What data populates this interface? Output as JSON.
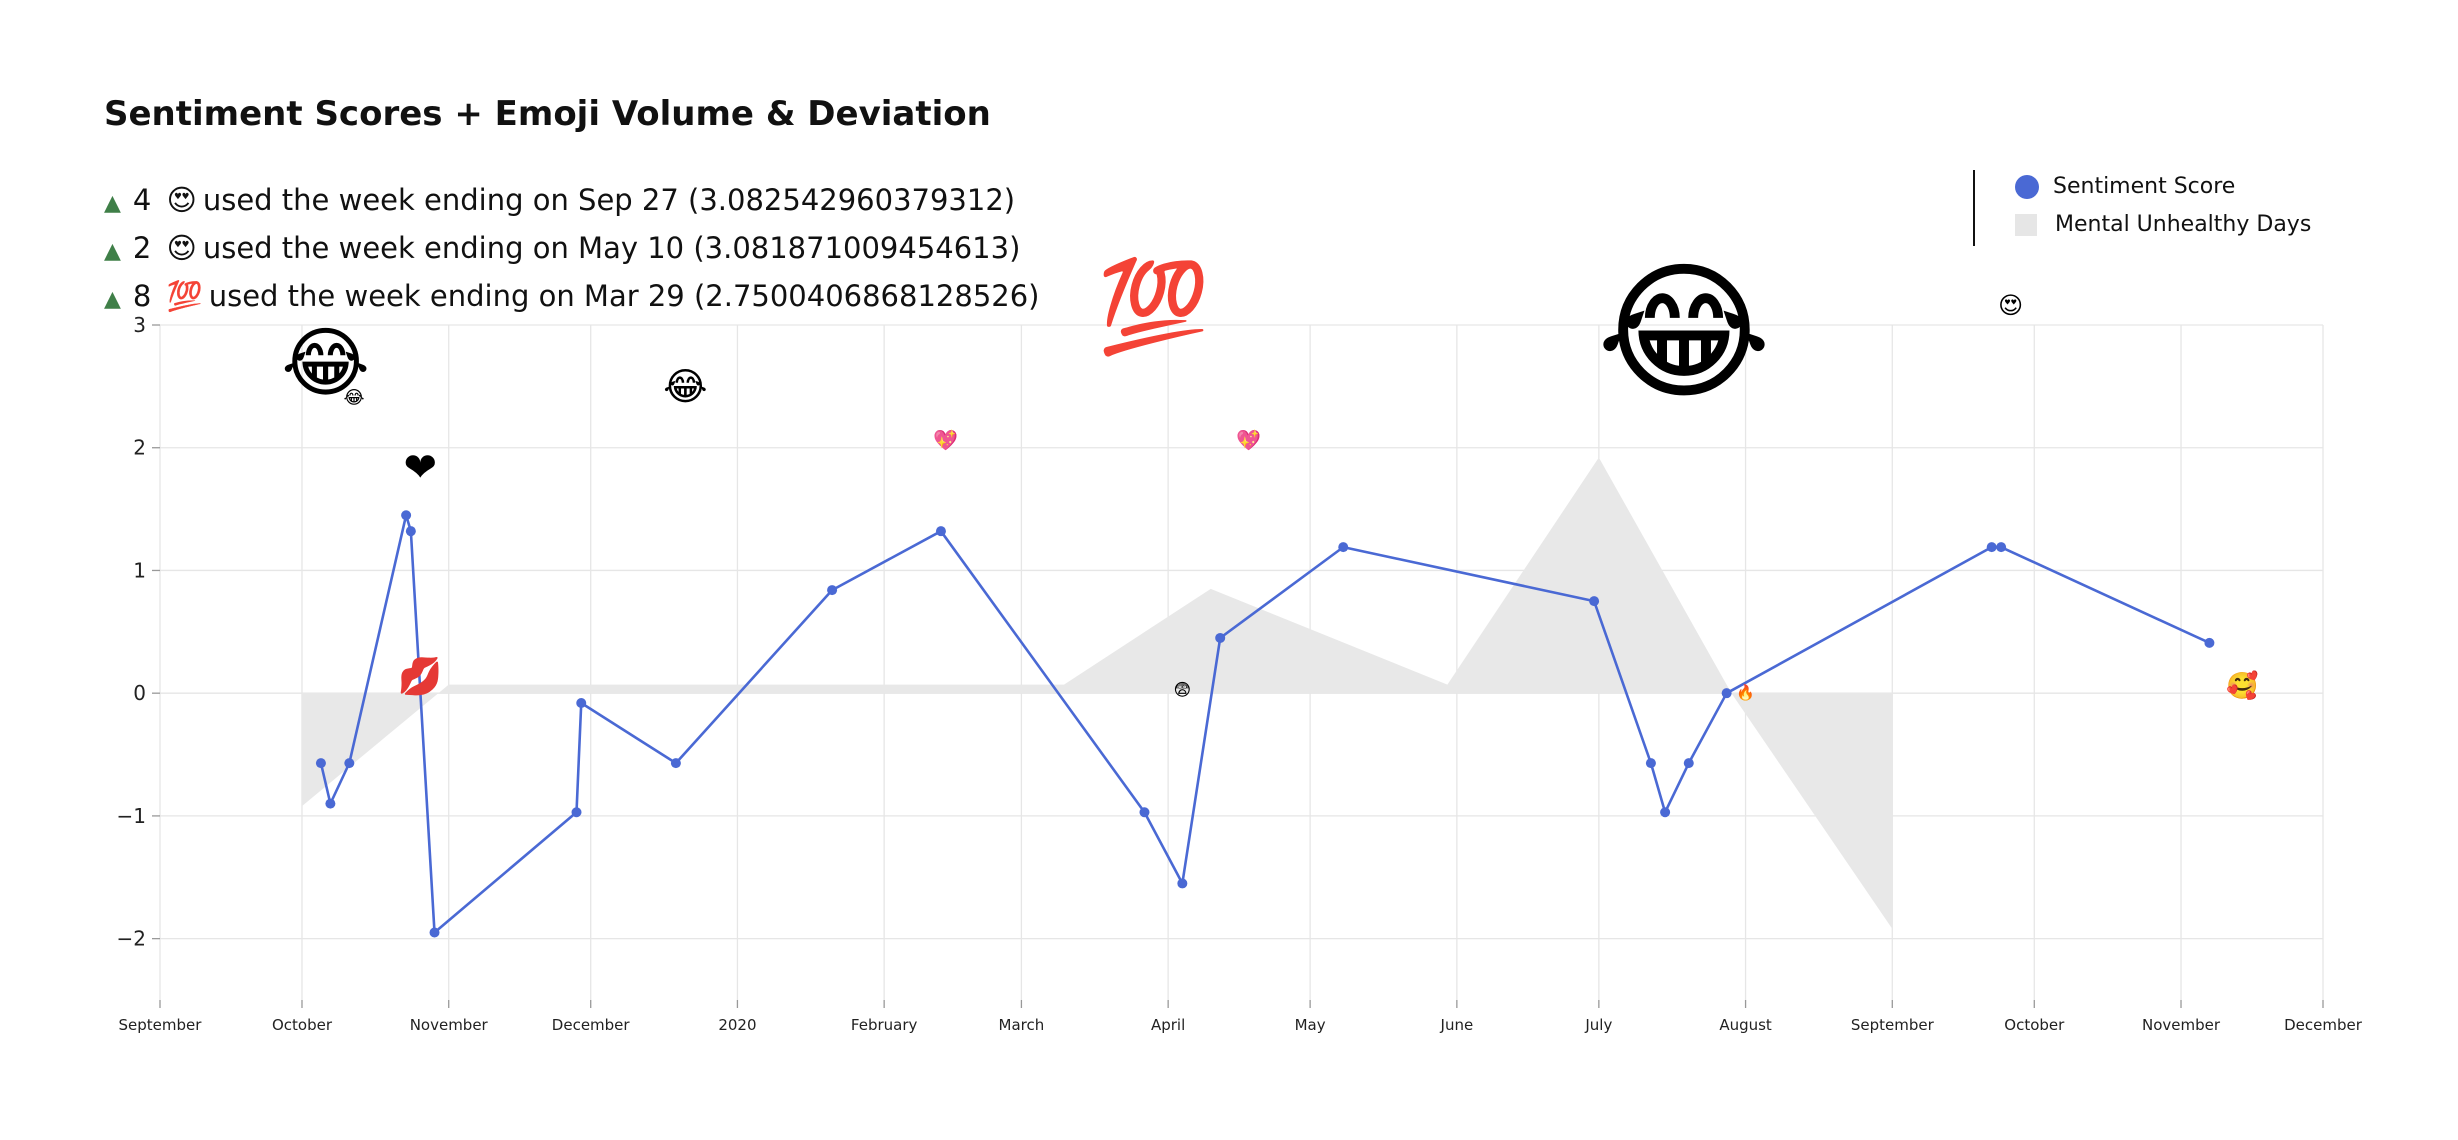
{
  "title": "Sentiment Scores + Emoji Volume & Deviation",
  "highlights": [
    {
      "count": "4",
      "emoji": "😍",
      "text": "used the week ending on Sep 27 (3.082542960379312)"
    },
    {
      "count": "2",
      "emoji": "😍",
      "text": "used the week ending on May 10 (3.081871009454613)"
    },
    {
      "count": "8",
      "emoji": "💯",
      "text": "used the week ending on Mar 29 (2.7500406868128526)"
    }
  ],
  "legend": {
    "sentiment": "Sentiment Score",
    "unhealthy": "Mental Unhealthy Days"
  },
  "colors": {
    "line": "#4a69d4",
    "area": "#e8e8e8",
    "grid": "#e6e6e6"
  },
  "chart_data": {
    "type": "line",
    "title": "Sentiment Scores + Emoji Volume & Deviation",
    "xlim": [
      "2019-09-01",
      "2020-12-01"
    ],
    "ylim": [
      -2.5,
      3
    ],
    "grid": true,
    "legend_position": "top-right",
    "x_ticks": [
      {
        "date": "2019-09-01",
        "label": "September"
      },
      {
        "date": "2019-10-01",
        "label": "October"
      },
      {
        "date": "2019-11-01",
        "label": "November"
      },
      {
        "date": "2019-12-01",
        "label": "December"
      },
      {
        "date": "2020-01-01",
        "label": "2020"
      },
      {
        "date": "2020-02-01",
        "label": "February"
      },
      {
        "date": "2020-03-01",
        "label": "March"
      },
      {
        "date": "2020-04-01",
        "label": "April"
      },
      {
        "date": "2020-05-01",
        "label": "May"
      },
      {
        "date": "2020-06-01",
        "label": "June"
      },
      {
        "date": "2020-07-01",
        "label": "July"
      },
      {
        "date": "2020-08-01",
        "label": "August"
      },
      {
        "date": "2020-09-01",
        "label": "September"
      },
      {
        "date": "2020-10-01",
        "label": "October"
      },
      {
        "date": "2020-11-01",
        "label": "November"
      },
      {
        "date": "2020-12-01",
        "label": "December"
      }
    ],
    "y_ticks": [
      {
        "value": 3,
        "label": "3"
      },
      {
        "value": 2,
        "label": "2"
      },
      {
        "value": 1,
        "label": "1"
      },
      {
        "value": 0,
        "label": "0"
      },
      {
        "value": -1,
        "label": "−1"
      },
      {
        "value": -2,
        "label": "−2"
      }
    ],
    "series": [
      {
        "name": "Sentiment Score",
        "points": [
          {
            "date": "2019-10-05",
            "y": -0.57
          },
          {
            "date": "2019-10-07",
            "y": -0.9
          },
          {
            "date": "2019-10-11",
            "y": -0.57
          },
          {
            "date": "2019-10-23",
            "y": 1.45
          },
          {
            "date": "2019-10-24",
            "y": 1.32
          },
          {
            "date": "2019-10-29",
            "y": -1.95
          },
          {
            "date": "2019-11-28",
            "y": -0.97
          },
          {
            "date": "2019-11-29",
            "y": -0.08
          },
          {
            "date": "2019-12-19",
            "y": -0.57
          },
          {
            "date": "2020-01-21",
            "y": 0.84
          },
          {
            "date": "2020-02-13",
            "y": 1.32
          },
          {
            "date": "2020-03-27",
            "y": -0.97
          },
          {
            "date": "2020-04-04",
            "y": -1.55
          },
          {
            "date": "2020-04-12",
            "y": 0.45
          },
          {
            "date": "2020-05-08",
            "y": 1.19
          },
          {
            "date": "2020-06-30",
            "y": 0.75
          },
          {
            "date": "2020-07-12",
            "y": -0.57
          },
          {
            "date": "2020-07-15",
            "y": -0.97
          },
          {
            "date": "2020-07-20",
            "y": -0.57
          },
          {
            "date": "2020-07-28",
            "y": 0.0
          },
          {
            "date": "2020-09-22",
            "y": 1.19
          },
          {
            "date": "2020-09-24",
            "y": 1.19
          },
          {
            "date": "2020-11-07",
            "y": 0.41
          }
        ]
      },
      {
        "name": "Mental Unhealthy Days",
        "points": [
          {
            "date": "2019-10-01",
            "y": 0.0
          },
          {
            "date": "2019-10-01",
            "y": -0.92
          },
          {
            "date": "2019-11-01",
            "y": 0.07
          },
          {
            "date": "2020-01-28",
            "y": 0.07
          },
          {
            "date": "2020-03-10",
            "y": 0.07
          },
          {
            "date": "2020-04-10",
            "y": 0.85
          },
          {
            "date": "2020-05-30",
            "y": 0.07
          },
          {
            "date": "2020-07-01",
            "y": 1.92
          },
          {
            "date": "2020-07-29",
            "y": 0.0
          },
          {
            "date": "2020-09-01",
            "y": -1.92
          },
          {
            "date": "2020-09-01",
            "y": 0.0
          }
        ]
      }
    ],
    "emoji_markers": [
      {
        "emoji": "😂",
        "date": "2019-10-06",
        "y": 2.65,
        "size": 76
      },
      {
        "emoji": "😂",
        "date": "2019-10-12",
        "y": 2.4,
        "size": 18
      },
      {
        "emoji": "❤",
        "date": "2019-10-26",
        "y": 1.82,
        "size": 40
      },
      {
        "emoji": "💋",
        "date": "2019-10-26",
        "y": 0.12,
        "size": 36
      },
      {
        "emoji": "😂",
        "date": "2019-12-21",
        "y": 2.48,
        "size": 38
      },
      {
        "emoji": "💖",
        "date": "2020-02-14",
        "y": 2.05,
        "size": 20
      },
      {
        "emoji": "💯",
        "date": "2020-03-29",
        "y": 3.1,
        "size": 90
      },
      {
        "emoji": "😨",
        "date": "2020-04-04",
        "y": 0.02,
        "size": 17
      },
      {
        "emoji": "💖",
        "date": "2020-04-18",
        "y": 2.05,
        "size": 20
      },
      {
        "emoji": "😂",
        "date": "2020-07-19",
        "y": 2.85,
        "size": 150
      },
      {
        "emoji": "🔥",
        "date": "2020-08-01",
        "y": 0.0,
        "size": 15
      },
      {
        "emoji": "😍",
        "date": "2020-09-26",
        "y": 3.15,
        "size": 24
      },
      {
        "emoji": "🥰",
        "date": "2020-11-14",
        "y": 0.05,
        "size": 26
      }
    ]
  }
}
